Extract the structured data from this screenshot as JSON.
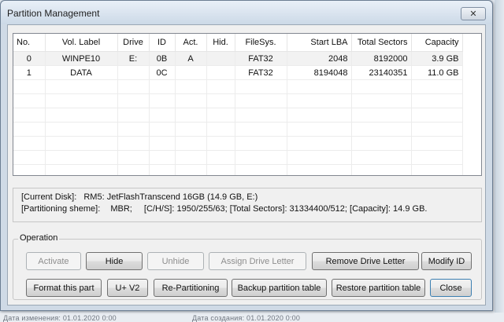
{
  "window": {
    "title": "Partition Management",
    "close_glyph": "✕"
  },
  "table": {
    "columns": [
      "No.",
      "Vol. Label",
      "Drive",
      "ID",
      "Act.",
      "Hid.",
      "FileSys.",
      "Start LBA",
      "Total Sectors",
      "Capacity"
    ],
    "rows": [
      {
        "no": "0",
        "label": "WINPE10",
        "drive": "E:",
        "id": "0B",
        "act": "A",
        "hid": "",
        "fs": "FAT32",
        "start": "2048",
        "total": "8192000",
        "cap": "3.9 GB"
      },
      {
        "no": "1",
        "label": "DATA",
        "drive": "",
        "id": "0C",
        "act": "",
        "hid": "",
        "fs": "FAT32",
        "start": "8194048",
        "total": "23140351",
        "cap": "11.0 GB"
      }
    ],
    "empty_row_count": 8
  },
  "info": {
    "current_disk_label": "[Current Disk]:",
    "current_disk_value": "RM5: JetFlashTranscend 16GB (14.9 GB, E:)",
    "scheme_label": "[Partitioning sheme]:",
    "scheme_value": "MBR;",
    "chs_text": "[C/H/S]: 1950/255/63; [Total Sectors]: 31334400/512; [Capacity]: 14.9 GB."
  },
  "operation": {
    "legend": "Operation",
    "buttons": {
      "activate": "Activate",
      "hide": "Hide",
      "unhide": "Unhide",
      "assign": "Assign Drive Letter",
      "remove": "Remove Drive Letter",
      "modify": "Modify ID",
      "format": "Format this part",
      "uv2": "U+ V2",
      "repart": "Re-Partitioning",
      "backup": "Backup partition table",
      "restore": "Restore partition table",
      "close": "Close"
    }
  },
  "background": {
    "left_text": "Дата изменения: 01.01.2020 0:00",
    "right_text": "Дата создания: 01.01.2020 0:00"
  }
}
